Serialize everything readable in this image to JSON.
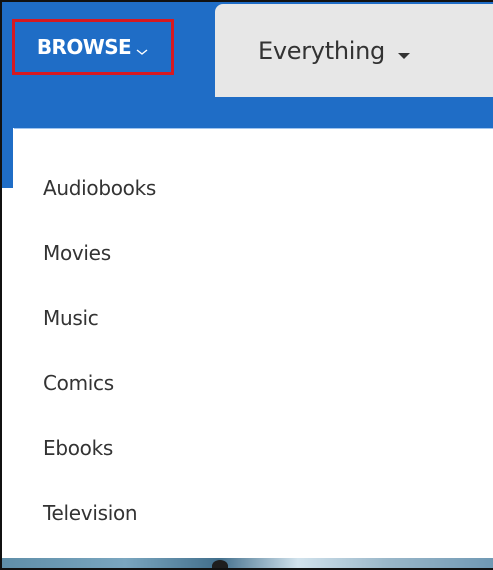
{
  "header": {
    "browse_label": "BROWSE",
    "browse_icon": "chevron-down-icon",
    "scope_label": "Everything",
    "scope_icon": "caret-down-icon"
  },
  "menu": {
    "items": [
      {
        "label": "Audiobooks"
      },
      {
        "label": "Movies"
      },
      {
        "label": "Music"
      },
      {
        "label": "Comics"
      },
      {
        "label": "Ebooks"
      },
      {
        "label": "Television"
      }
    ]
  },
  "colors": {
    "accent_blue": "#1f6dc6",
    "highlight_red": "#d71920",
    "tab_gray": "#e7e7e7",
    "text_dark": "#333333"
  }
}
